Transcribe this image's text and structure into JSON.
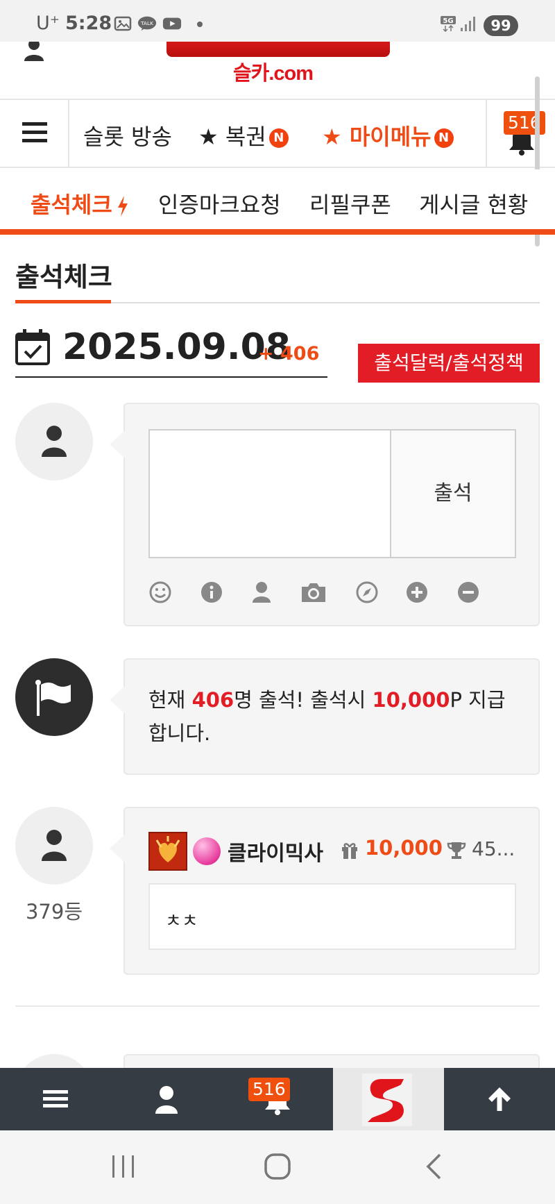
{
  "status_bar": {
    "carrier": "U⁺",
    "time": "5:28",
    "battery": "99"
  },
  "header": {
    "logo_domain": "슬카.com"
  },
  "top_nav": {
    "items": [
      {
        "label": "슬롯 방송"
      },
      {
        "label": "★ 복권",
        "badge": "N"
      },
      {
        "label": "★ 마이메뉴",
        "badge": "N"
      }
    ],
    "notification_count": "516"
  },
  "sub_nav": {
    "tabs": [
      {
        "label": "출석체크",
        "active": true
      },
      {
        "label": "인증마크요청"
      },
      {
        "label": "리필쿠폰"
      },
      {
        "label": "게시글 현황"
      }
    ]
  },
  "page": {
    "title": "출석체크",
    "date": "2025.09.08",
    "count_delta": "+ 406",
    "policy_button": "출석달력/출석정책"
  },
  "entry": {
    "text_value": "",
    "checkin_button": "출석",
    "tools": [
      "smile-icon",
      "info-icon",
      "user-icon",
      "camera-icon",
      "compass-icon",
      "plus-circle-icon",
      "minus-circle-icon"
    ]
  },
  "notice": {
    "prefix": "현재 ",
    "count": "406",
    "middle": "명 출석! 출석시 ",
    "points": "10,000",
    "suffix": "P 지급합니다."
  },
  "post": {
    "username": "클라이믹사",
    "points": "10,000",
    "rank_points": "45...",
    "rank": "379등",
    "comment": "ㅊㅊ"
  },
  "bottom_bar": {
    "notification_count": "516"
  },
  "colors": {
    "accent": "#ee4b16",
    "red": "#e21d26",
    "bottom_bar": "#363c44"
  }
}
